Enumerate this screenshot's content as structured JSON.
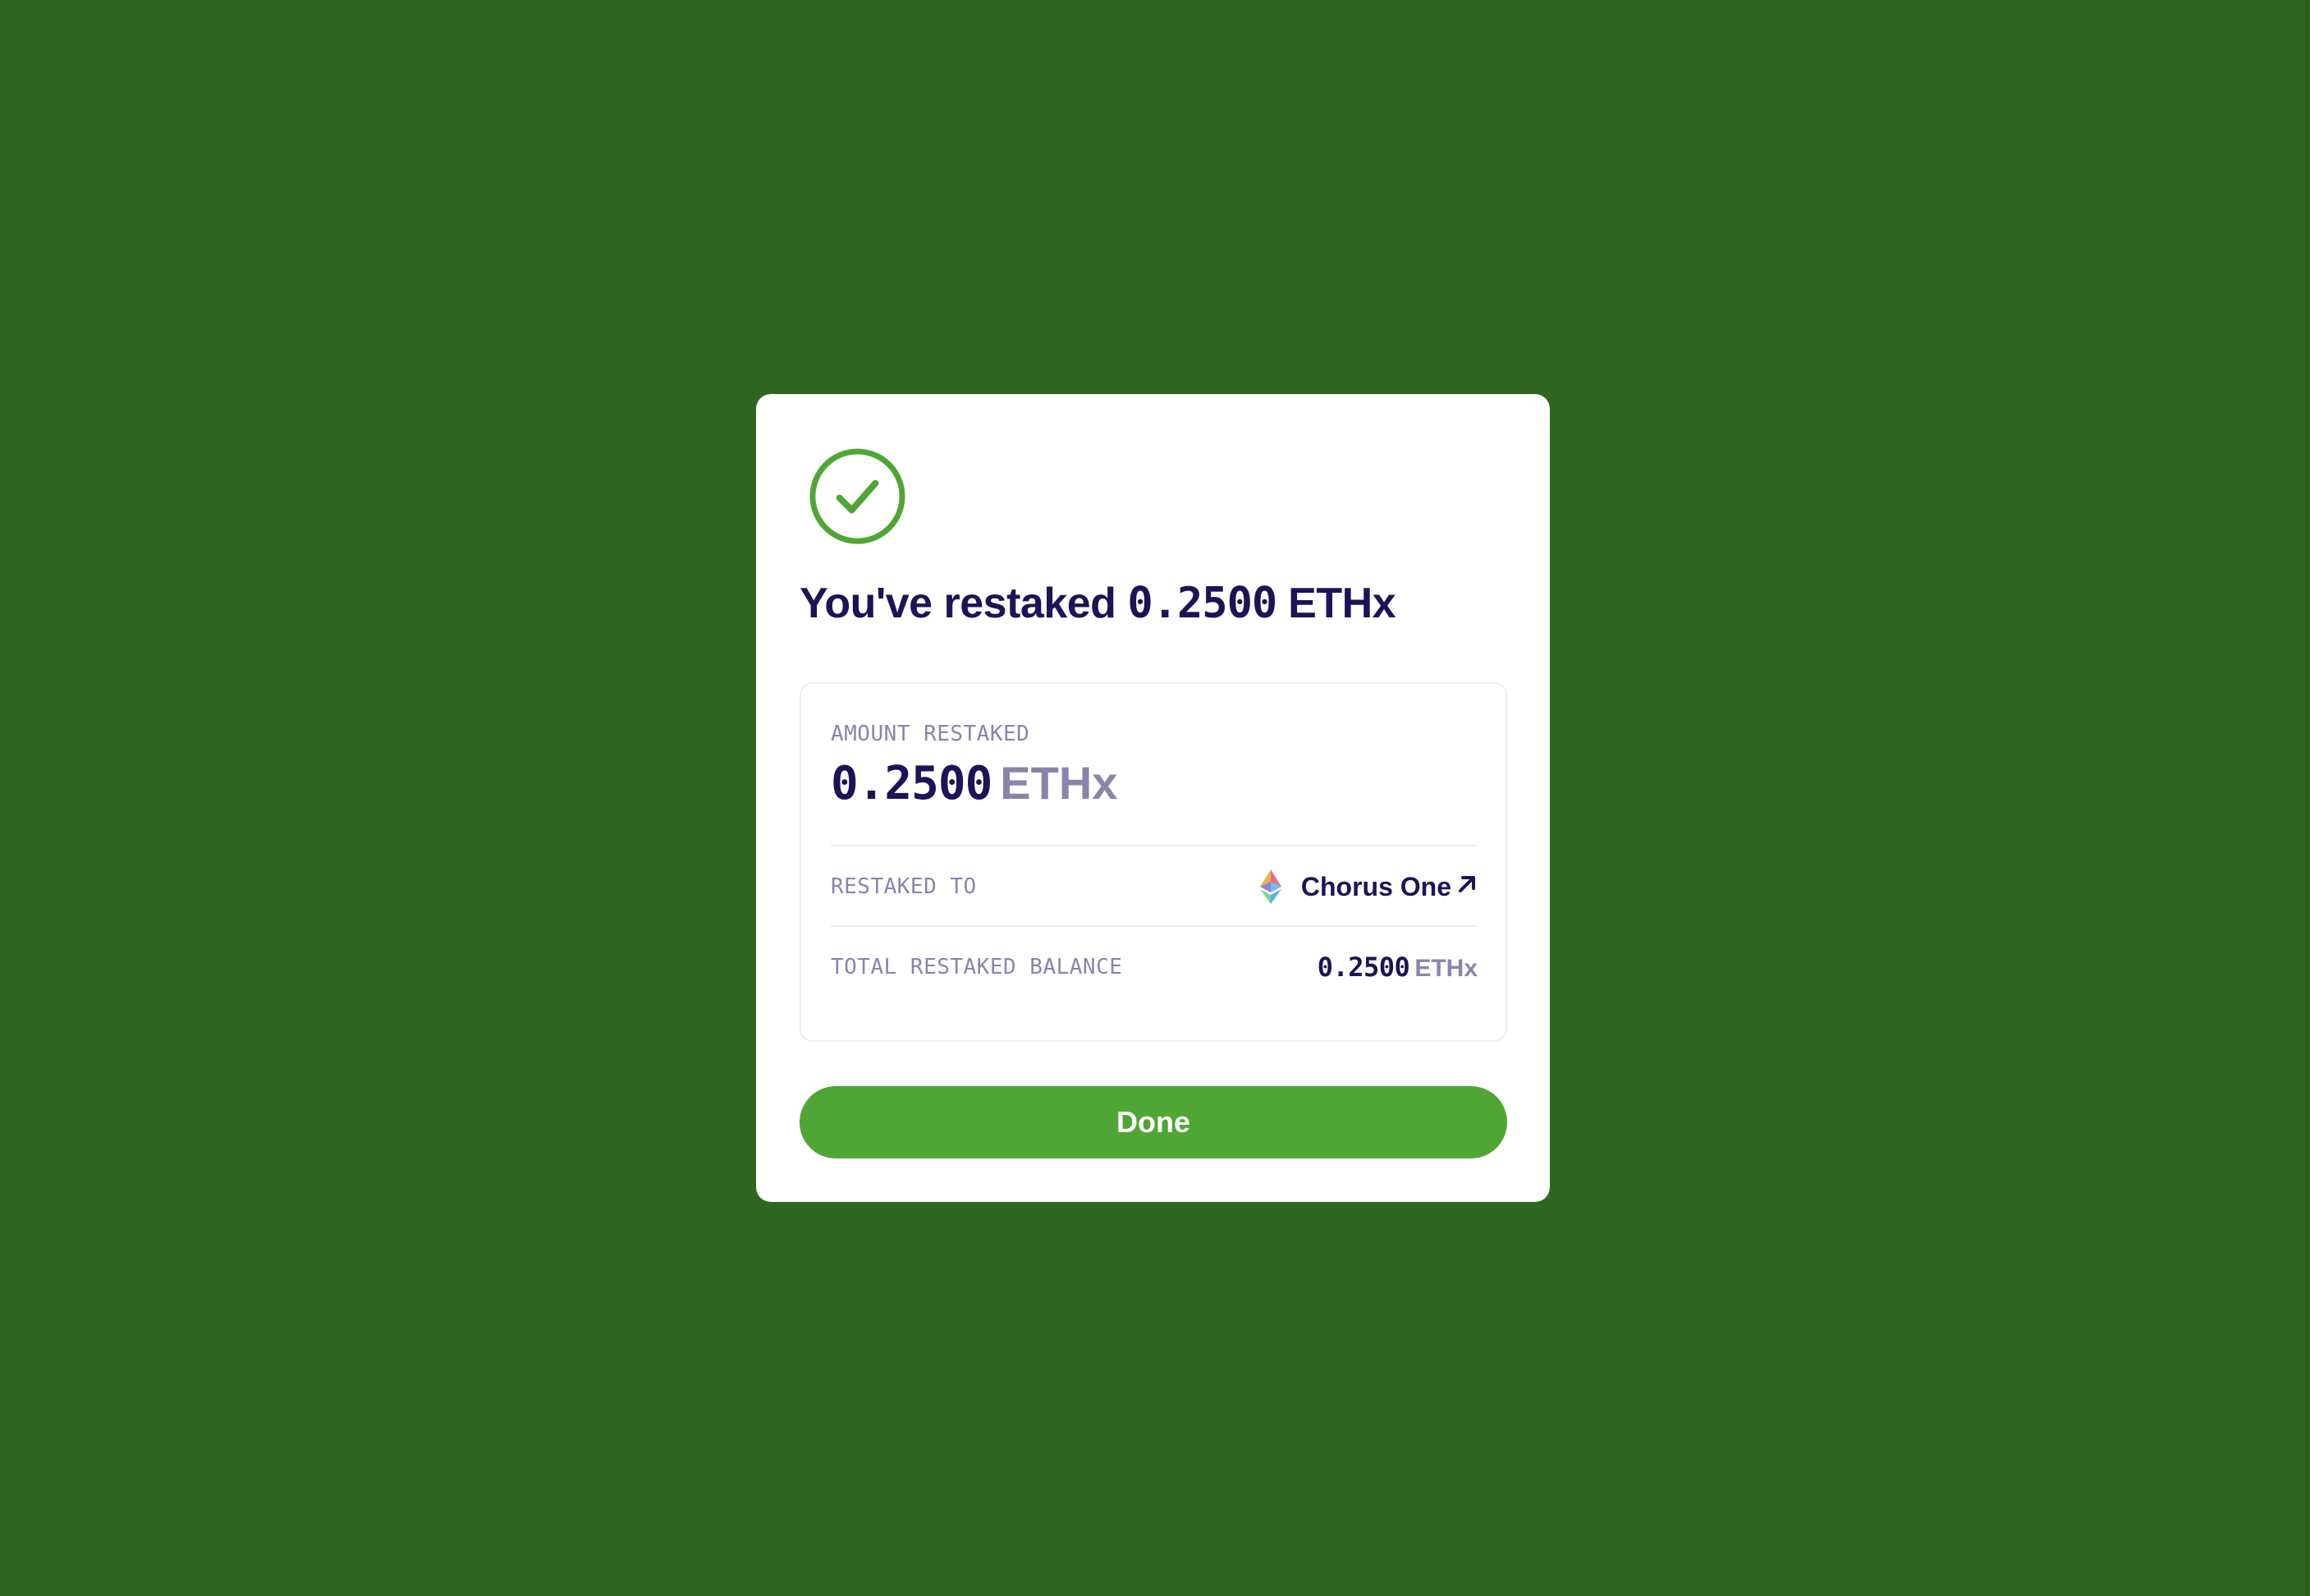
{
  "modal": {
    "title_prefix": "You've restaked",
    "title_amount": "0.2500",
    "title_unit": "ETHx",
    "details": {
      "amount_label": "AMOUNT RESTAKED",
      "amount_value": "0.2500",
      "amount_unit": "ETHx",
      "restaked_to_label": "RESTAKED TO",
      "validator_name": "Chorus One",
      "validator_icon": "ethereum-icon",
      "external_icon": "arrow-up-right-icon",
      "total_label": "TOTAL RESTAKED BALANCE",
      "total_value": "0.2500",
      "total_unit": "ETHx"
    },
    "done_label": "Done"
  },
  "colors": {
    "background": "#2f6720",
    "accent_green": "#4fa634",
    "text_dark": "#1c1456",
    "text_muted": "#8b84aa"
  }
}
